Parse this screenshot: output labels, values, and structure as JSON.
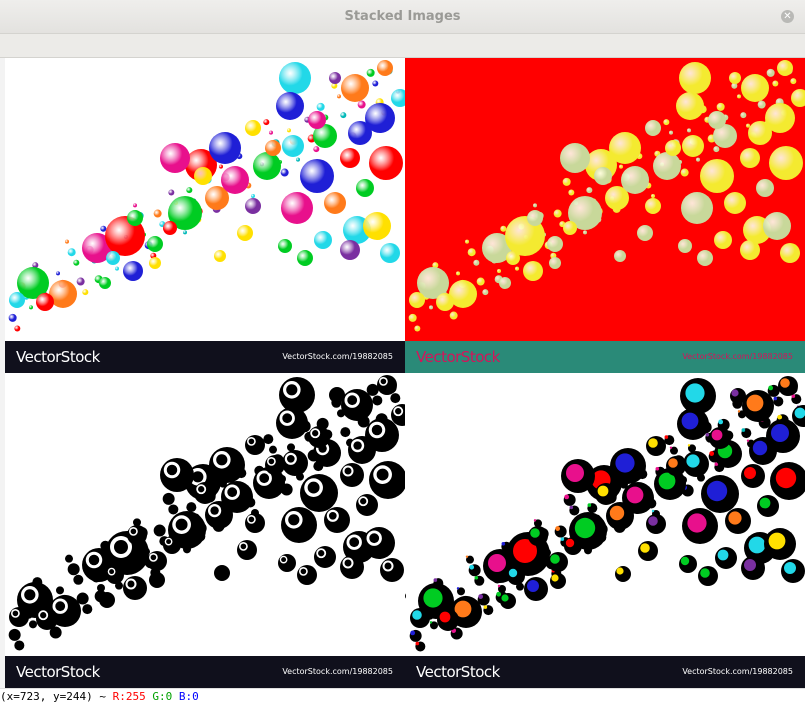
{
  "window": {
    "title": "Stacked Images"
  },
  "panels": [
    {
      "watermark_logo": "VectorStock",
      "watermark_url": "VectorStock.com/19882085"
    },
    {
      "watermark_logo": "VectorStock",
      "watermark_url": "VectorStock.com/19882085"
    },
    {
      "watermark_logo": "VectorStock",
      "watermark_url": "VectorStock.com/19882085"
    },
    {
      "watermark_logo": "VectorStock",
      "watermark_url": "VectorStock.com/19882085"
    }
  ],
  "status": {
    "coords": "(x=723, y=244) ~",
    "r_label": "R:255",
    "g_label": "G:0",
    "b_label": "B:0",
    "r_color": "#ff0000",
    "g_color": "#00a000",
    "b_color": "#0000ff"
  },
  "colors": {
    "banner_dark": "#10101c",
    "banner_teal": "#2a8a78",
    "panel2_background": "#ff0000"
  }
}
